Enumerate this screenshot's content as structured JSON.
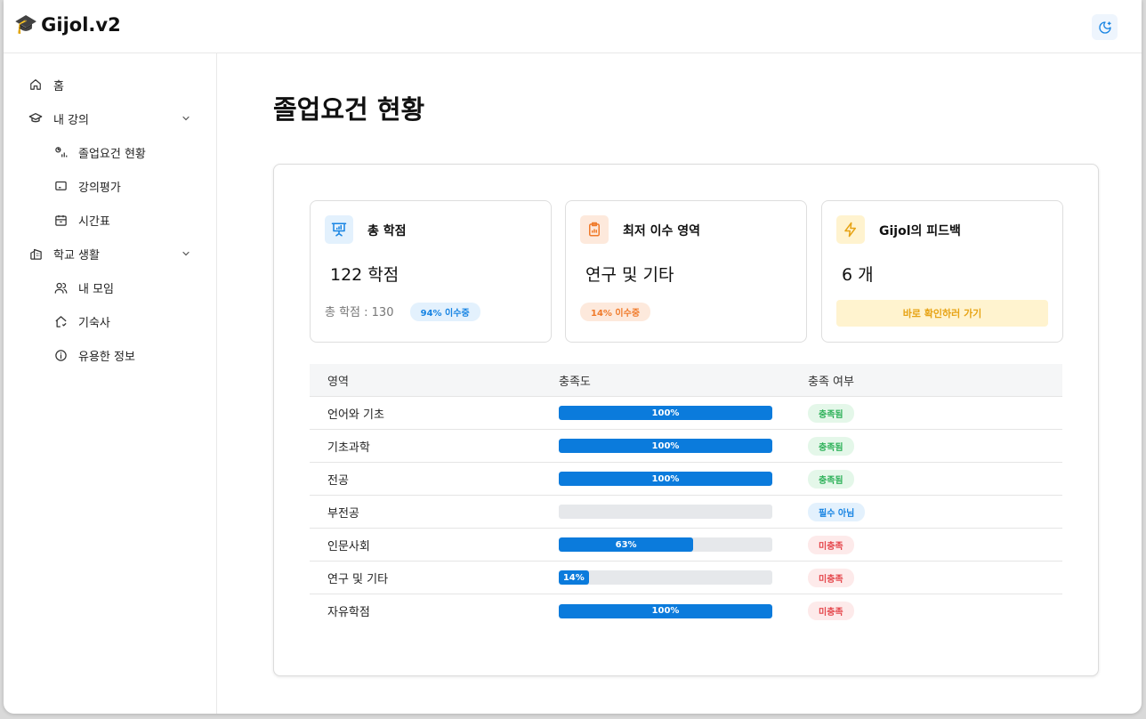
{
  "app": {
    "title": "Gijol.v2",
    "theme_toggle_icon": "moon-icon"
  },
  "sidebar": {
    "items": [
      {
        "label": "홈",
        "icon": "home-icon"
      },
      {
        "label": "내 강의",
        "icon": "graduation-cap-icon",
        "expanded": true
      },
      {
        "label": "졸업요건 현황",
        "icon": "chart-icon"
      },
      {
        "label": "강의평가",
        "icon": "review-icon"
      },
      {
        "label": "시간표",
        "icon": "calendar-icon"
      },
      {
        "label": "학교 생활",
        "icon": "building-icon",
        "expanded": true
      },
      {
        "label": "내 모임",
        "icon": "users-icon"
      },
      {
        "label": "기숙사",
        "icon": "house-icon"
      },
      {
        "label": "유용한 정보",
        "icon": "info-icon"
      }
    ]
  },
  "main": {
    "title": "졸업요건 현황",
    "cards": {
      "total": {
        "title": "총 학점",
        "value": "122 학점",
        "sub": "총 학점 : 130",
        "badge": "94% 이수중",
        "icon": "presentation-icon",
        "icon_color": "#1784e3"
      },
      "min_area": {
        "title": "최저 이수 영역",
        "value": "연구 및 기타",
        "badge": "14% 이수중",
        "icon": "clipboard-icon",
        "icon_color": "#f07a2a"
      },
      "feedback": {
        "title": "Gijol의 피드백",
        "value": "6 개",
        "button": "바로 확인하러 가기",
        "icon": "bolt-icon",
        "icon_color": "#e7a416"
      }
    },
    "table": {
      "headers": [
        "영역",
        "충족도",
        "충족 여부"
      ],
      "rows": [
        {
          "area": "언어와 기초",
          "percent": 100,
          "percent_label": "100%",
          "status": "충족됨",
          "status_type": "green"
        },
        {
          "area": "기초과학",
          "percent": 100,
          "percent_label": "100%",
          "status": "충족됨",
          "status_type": "green"
        },
        {
          "area": "전공",
          "percent": 100,
          "percent_label": "100%",
          "status": "충족됨",
          "status_type": "green"
        },
        {
          "area": "부전공",
          "percent": 0,
          "percent_label": "",
          "status": "필수 아님",
          "status_type": "blue"
        },
        {
          "area": "인문사회",
          "percent": 63,
          "percent_label": "63%",
          "status": "미충족",
          "status_type": "red"
        },
        {
          "area": "연구 및 기타",
          "percent": 14,
          "percent_label": "14%",
          "status": "미충족",
          "status_type": "red"
        },
        {
          "area": "자유학점",
          "percent": 100,
          "percent_label": "100%",
          "status": "미충족",
          "status_type": "red"
        }
      ]
    }
  }
}
